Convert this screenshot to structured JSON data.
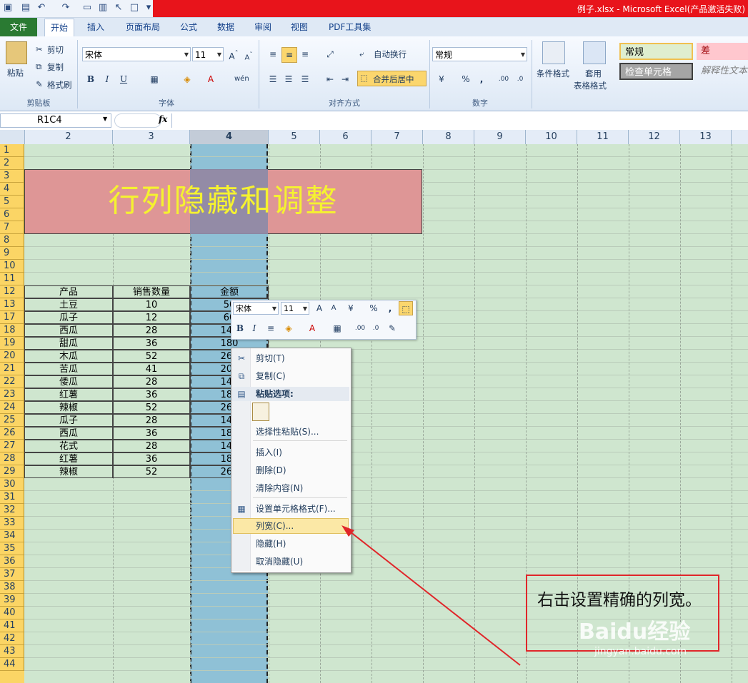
{
  "window": {
    "title": "例子.xlsx - Microsoft Excel(产品激活失败)"
  },
  "tabs": [
    "文件",
    "开始",
    "插入",
    "页面布局",
    "公式",
    "数据",
    "审阅",
    "视图",
    "PDF工具集"
  ],
  "ribbon": {
    "clipboard": {
      "paste": "粘贴",
      "cut": "剪切",
      "copy": "复制",
      "format_painter": "格式刷",
      "label": "剪贴板"
    },
    "font": {
      "name": "宋体",
      "size": "11",
      "bold": "B",
      "italic": "I",
      "underline": "U",
      "label": "字体"
    },
    "alignment": {
      "wrap": "自动换行",
      "merge": "合并后居中",
      "label": "对齐方式"
    },
    "number": {
      "format": "常规",
      "percent": "%",
      "comma": ",",
      "label": "数字"
    },
    "styles": {
      "conditional": "条件格式",
      "table_line1": "套用",
      "table_line2": "表格格式",
      "normal": "常规",
      "bad": "差",
      "check": "检查单元格",
      "explain": "解释性文本"
    }
  },
  "formula_bar": {
    "name_box": "R1C4",
    "fx": "fx",
    "content": ""
  },
  "columns": [
    "2",
    "3",
    "4",
    "5",
    "6",
    "7",
    "8",
    "9",
    "10",
    "11",
    "12",
    "13"
  ],
  "rows": [
    "1",
    "2",
    "3",
    "4",
    "5",
    "6",
    "7",
    "8",
    "9",
    "10",
    "11",
    "12",
    "13",
    "17",
    "18",
    "19",
    "20",
    "21",
    "22",
    "23",
    "24",
    "25",
    "26",
    "27",
    "28",
    "29",
    "30",
    "31",
    "32",
    "33",
    "34",
    "35",
    "36",
    "37",
    "38",
    "39",
    "40",
    "41",
    "42",
    "43",
    "44"
  ],
  "sheet": {
    "title": "行列隐藏和调整",
    "headers": [
      "产品",
      "销售数量",
      "金额"
    ],
    "table": [
      [
        "土豆",
        "10",
        "50"
      ],
      [
        "瓜子",
        "12",
        "60"
      ],
      [
        "西瓜",
        "28",
        "140"
      ],
      [
        "甜瓜",
        "36",
        "180"
      ],
      [
        "木瓜",
        "52",
        "260"
      ],
      [
        "苦瓜",
        "41",
        "205"
      ],
      [
        "倭瓜",
        "28",
        "140"
      ],
      [
        "红薯",
        "36",
        "180"
      ],
      [
        "辣椒",
        "52",
        "260"
      ],
      [
        "瓜子",
        "28",
        "140"
      ],
      [
        "西瓜",
        "36",
        "180"
      ],
      [
        "花式",
        "28",
        "140"
      ],
      [
        "红薯",
        "36",
        "180"
      ],
      [
        "辣椒",
        "52",
        "260"
      ]
    ]
  },
  "mini_toolbar": {
    "font": "宋体",
    "size": "11",
    "percent": "%",
    "comma": ",",
    "bold": "B",
    "italic": "I"
  },
  "context_menu": {
    "cut": "剪切(T)",
    "copy": "复制(C)",
    "paste_options": "粘贴选项:",
    "paste_special": "选择性粘贴(S)...",
    "insert": "插入(I)",
    "delete": "删除(D)",
    "clear": "清除内容(N)",
    "format_cells": "设置单元格格式(F)...",
    "column_width": "列宽(C)...",
    "hide": "隐藏(H)",
    "unhide": "取消隐藏(U)"
  },
  "annotation": {
    "text": "右击设置精确的列宽。"
  },
  "watermark": {
    "brand": "Baidu经验",
    "url": "jingyan.baidu.com"
  },
  "colors": {
    "file_tab": "#2a7a32",
    "titlebar_red": "#e8141b",
    "sheet_bg": "#cfe6cf",
    "selection": "#8fc1d6",
    "title_fill": "#de9696",
    "title_text": "#f5f230",
    "arrow": "#e0262a"
  }
}
